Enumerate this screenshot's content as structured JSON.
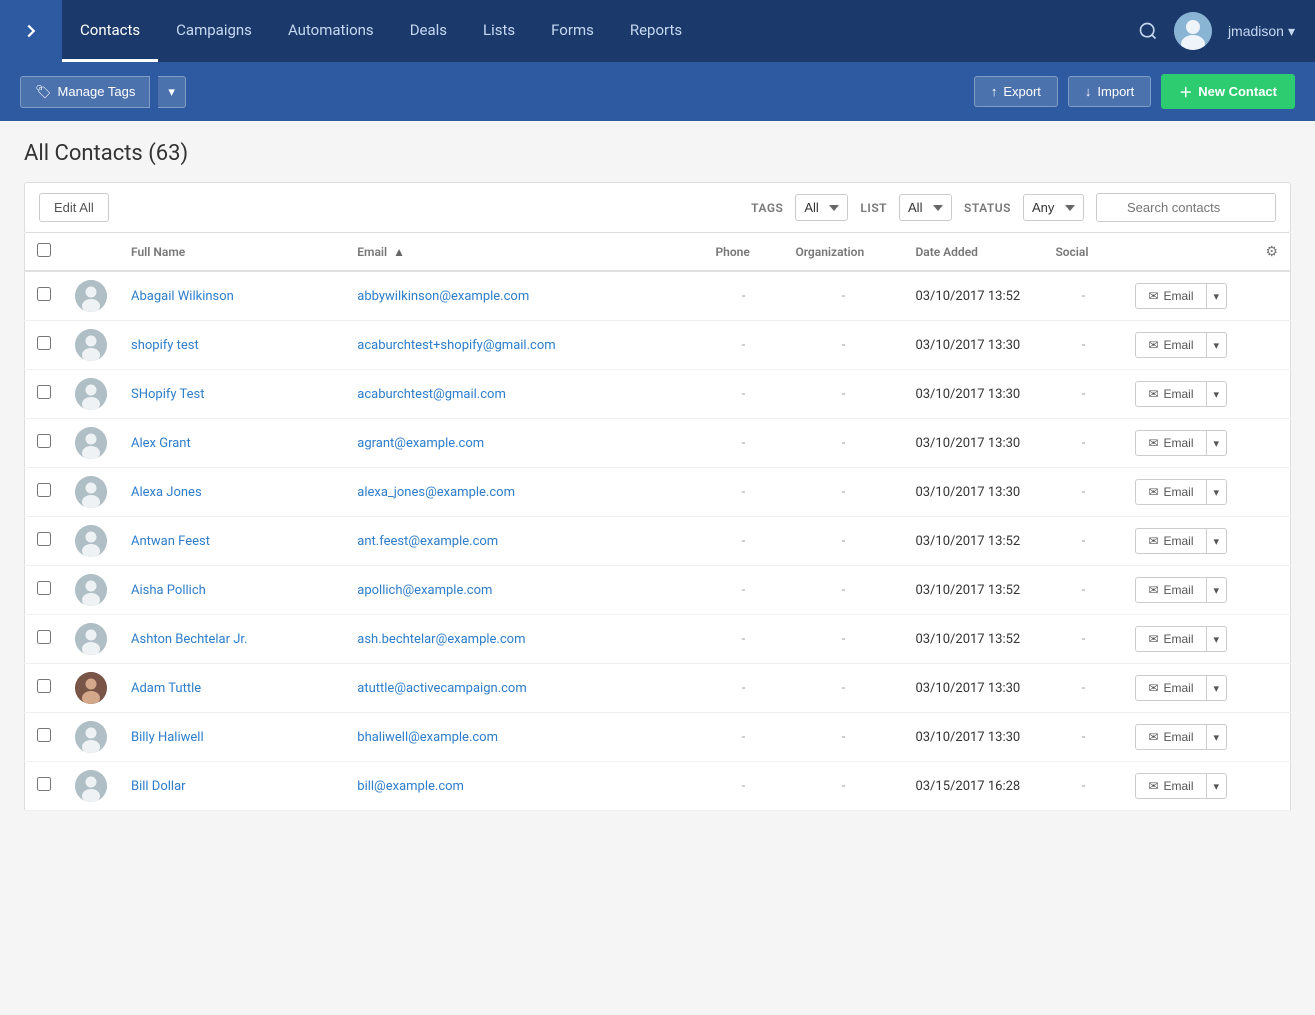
{
  "nav": {
    "toggle_icon": "›",
    "links": [
      {
        "label": "Contacts",
        "active": true
      },
      {
        "label": "Campaigns",
        "active": false
      },
      {
        "label": "Automations",
        "active": false
      },
      {
        "label": "Deals",
        "active": false
      },
      {
        "label": "Lists",
        "active": false
      },
      {
        "label": "Forms",
        "active": false
      },
      {
        "label": "Reports",
        "active": false
      }
    ],
    "username": "jmadison"
  },
  "toolbar": {
    "manage_tags_label": "Manage Tags",
    "export_label": "Export",
    "import_label": "Import",
    "new_contact_label": "New Contact"
  },
  "page": {
    "title": "All Contacts (63)"
  },
  "filters": {
    "edit_all_label": "Edit All",
    "tags_label": "TAGS",
    "tags_value": "All",
    "list_label": "LIST",
    "list_value": "All",
    "status_label": "STATUS",
    "status_value": "Any",
    "search_placeholder": "Search contacts"
  },
  "table": {
    "columns": [
      "Full Name",
      "Email",
      "Phone",
      "Organization",
      "Date Added",
      "Social"
    ],
    "email_sort": "▲",
    "contacts": [
      {
        "name": "Abagail Wilkinson",
        "email": "abbywilkinson@example.com",
        "phone": "-",
        "org": "-",
        "date": "03/10/2017 13:52",
        "social": "-",
        "has_avatar": false
      },
      {
        "name": "shopify test",
        "email": "acaburchtest+shopify@gmail.com",
        "phone": "-",
        "org": "-",
        "date": "03/10/2017 13:30",
        "social": "-",
        "has_avatar": false
      },
      {
        "name": "SHopify Test",
        "email": "acaburchtest@gmail.com",
        "phone": "-",
        "org": "-",
        "date": "03/10/2017 13:30",
        "social": "-",
        "has_avatar": false
      },
      {
        "name": "Alex Grant",
        "email": "agrant@example.com",
        "phone": "-",
        "org": "-",
        "date": "03/10/2017 13:30",
        "social": "-",
        "has_avatar": false
      },
      {
        "name": "Alexa Jones",
        "email": "alexa_jones@example.com",
        "phone": "-",
        "org": "-",
        "date": "03/10/2017 13:30",
        "social": "-",
        "has_avatar": false
      },
      {
        "name": "Antwan Feest",
        "email": "ant.feest@example.com",
        "phone": "-",
        "org": "-",
        "date": "03/10/2017 13:52",
        "social": "-",
        "has_avatar": false
      },
      {
        "name": "Aisha Pollich",
        "email": "apollich@example.com",
        "phone": "-",
        "org": "-",
        "date": "03/10/2017 13:52",
        "social": "-",
        "has_avatar": false
      },
      {
        "name": "Ashton Bechtelar Jr.",
        "email": "ash.bechtelar@example.com",
        "phone": "-",
        "org": "-",
        "date": "03/10/2017 13:52",
        "social": "-",
        "has_avatar": false
      },
      {
        "name": "Adam Tuttle",
        "email": "atuttle@activecampaign.com",
        "phone": "-",
        "org": "-",
        "date": "03/10/2017 13:30",
        "social": "-",
        "has_avatar": true
      },
      {
        "name": "Billy Haliwell",
        "email": "bhaliwell@example.com",
        "phone": "-",
        "org": "-",
        "date": "03/10/2017 13:30",
        "social": "-",
        "has_avatar": false
      },
      {
        "name": "Bill Dollar",
        "email": "bill@example.com",
        "phone": "-",
        "org": "-",
        "date": "03/15/2017 16:28",
        "social": "-",
        "has_avatar": false
      }
    ],
    "email_btn_label": "Email",
    "settings_icon": "⚙"
  }
}
